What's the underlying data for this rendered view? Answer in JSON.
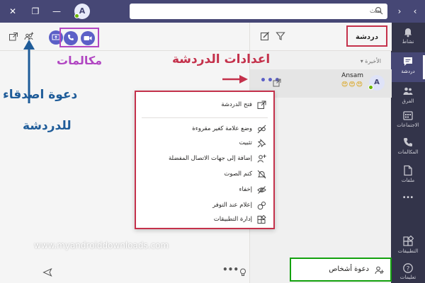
{
  "titlebar": {
    "search_placeholder": "بحث",
    "avatar_initial": "A",
    "close_symbol": "✕",
    "minimize_symbol": "—",
    "restore_symbol": "❐",
    "back_symbol": "‹",
    "forward_symbol": "›"
  },
  "rail": {
    "items": [
      {
        "label": "نشاط",
        "icon": "bell-icon",
        "active": false
      },
      {
        "label": "دردشة",
        "icon": "chat-icon",
        "active": true
      },
      {
        "label": "الفرق",
        "icon": "teams-icon",
        "active": false
      },
      {
        "label": "الاجتماعات",
        "icon": "calendar-icon",
        "active": false
      },
      {
        "label": "المكالمات",
        "icon": "phone-icon",
        "active": false
      },
      {
        "label": "ملفات",
        "icon": "files-icon",
        "active": false
      }
    ],
    "more_label": "...",
    "apps_label": "التطبيقات",
    "help_label": "تعليمات"
  },
  "list": {
    "title": "دردشة",
    "recent_label": "الأخيرة",
    "chat": {
      "name": "Ansam",
      "preview": "😍😍😍",
      "avatar_initial": "A",
      "more": "•••"
    },
    "invite_label": "دعوة أشخاص"
  },
  "annotations": {
    "calls": "مكالمات",
    "chat_settings": "اعدادات الدردشة",
    "invite_line1": "دعوة اصدقاء",
    "invite_line2": "للدردشة"
  },
  "menu": {
    "items": [
      {
        "label": "فتح الدردشة",
        "icon": "popout-icon"
      },
      {
        "label": "وضع علامة كغير مقروءة",
        "icon": "unread-icon"
      },
      {
        "label": "تثبيت",
        "icon": "pin-icon"
      },
      {
        "label": "إضافة إلى جهات الاتصال المفضلة",
        "icon": "add-contact-icon"
      },
      {
        "label": "كتم الصوت",
        "icon": "mute-icon"
      },
      {
        "label": "إخفاء",
        "icon": "hide-icon"
      },
      {
        "label": "إعلام عند التوفر",
        "icon": "notify-icon"
      },
      {
        "label": "إدارة التطبيقات",
        "icon": "apps-icon"
      }
    ]
  },
  "watermark": "www.myandroiddownloads.com",
  "composer": {
    "more": "•••"
  },
  "colors": {
    "titlebar": "#464775",
    "rail": "#33344a",
    "accent": "#5b5fc7",
    "annot_red": "#c4314b",
    "annot_purple": "#b146c2",
    "annot_blue": "#1f5c99",
    "annot_green": "#13a10e"
  }
}
